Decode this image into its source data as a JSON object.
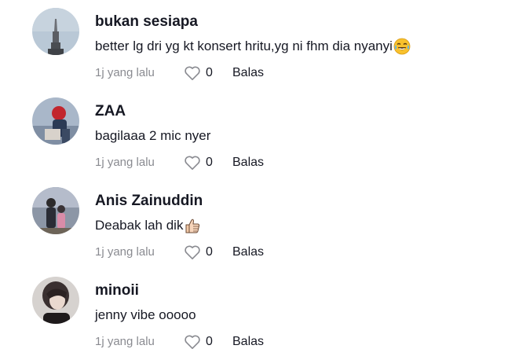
{
  "comments": [
    {
      "username": "bukan sesiapa",
      "text": "better lg dri yg kt konsert hritu,yg ni fhm dia nyanyi",
      "emoji": "face-with-tears-of-joy",
      "time": "1j yang lalu",
      "likes": "0",
      "reply_label": "Balas"
    },
    {
      "username": "ZAA",
      "text": "bagilaaa 2 mic nyer",
      "emoji": "",
      "time": "1j yang lalu",
      "likes": "0",
      "reply_label": "Balas"
    },
    {
      "username": "Anis Zainuddin",
      "text": "Deabak lah dik",
      "emoji": "thumbs-up",
      "time": "1j yang lalu",
      "likes": "0",
      "reply_label": "Balas"
    },
    {
      "username": "minoii",
      "text": "jenny vibe ooooo",
      "emoji": "",
      "time": "1j yang lalu",
      "likes": "0",
      "reply_label": "Balas"
    }
  ]
}
